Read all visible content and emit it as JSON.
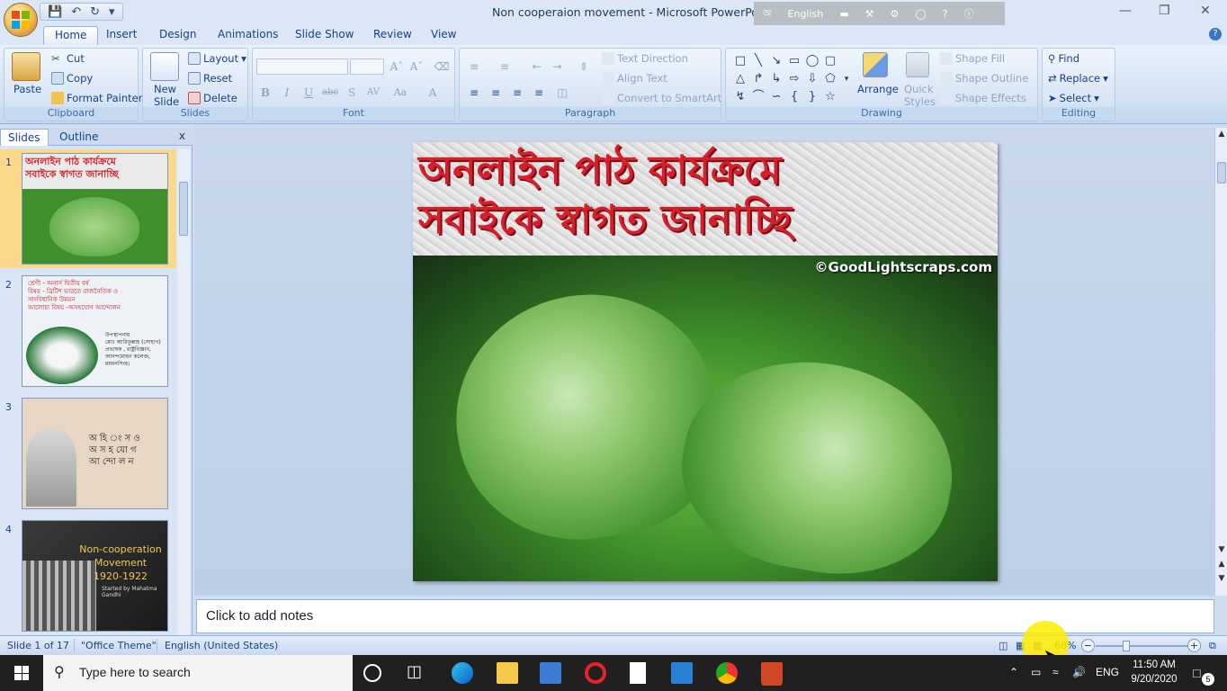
{
  "window": {
    "title": "Non cooperaion movement - Microsoft PowerPoint",
    "language_indicator": "English"
  },
  "tabs": [
    "Home",
    "Insert",
    "Design",
    "Animations",
    "Slide Show",
    "Review",
    "View"
  ],
  "ribbon": {
    "clipboard": {
      "paste": "Paste",
      "cut": "Cut",
      "copy": "Copy",
      "format_painter": "Format Painter",
      "label": "Clipboard"
    },
    "slides": {
      "new_slide": "New\nSlide",
      "new_slide_line1": "New",
      "new_slide_line2": "Slide",
      "layout": "Layout",
      "reset": "Reset",
      "delete": "Delete",
      "label": "Slides"
    },
    "font": {
      "label": "Font",
      "buttons": [
        "B",
        "I",
        "U",
        "abc",
        "S",
        "AV",
        "Aa",
        "A"
      ]
    },
    "paragraph": {
      "text_direction": "Text Direction",
      "align_text": "Align Text",
      "convert_smartart": "Convert to SmartArt",
      "label": "Paragraph"
    },
    "drawing": {
      "arrange": "Arrange",
      "quick_styles_line1": "Quick",
      "quick_styles_line2": "Styles",
      "shape_fill": "Shape Fill",
      "shape_outline": "Shape Outline",
      "shape_effects": "Shape Effects",
      "label": "Drawing"
    },
    "editing": {
      "find": "Find",
      "replace": "Replace",
      "select": "Select",
      "label": "Editing"
    }
  },
  "left_pane": {
    "tabs": [
      "Slides",
      "Outline"
    ],
    "close": "x",
    "slides": [
      {
        "number": "1",
        "title_line1": "অনলাইন পাঠ কার্যক্রমে",
        "title_line2": "সবাইকে স্বাগত জানাচ্ছি",
        "selected": true
      },
      {
        "number": "2",
        "lines": [
          "শ্রেণী - অনার্স দ্বিতীয় বর্ষ",
          "বিষয় - ব্রিটিশ ভারতে রাজনৈতিক ও",
          "সাংবিধানিক উন্নয়ন",
          "আলোচ্য বিষয় -অসহযোগ আন্দোলন"
        ],
        "presenter": [
          "উপস্থাপনায়",
          "মোঃ আরিফুল্লাহ (সোহাগ)",
          "প্রভাষক , রাষ্ট্রবিজ্ঞান,",
          "আনন্দমোহন কলেজ,",
          "ময়মনসিংহ।"
        ]
      },
      {
        "number": "3",
        "lines": [
          "অ হি ং স  ও",
          "অ স হ যো গ",
          "আ ন্দো ল ন"
        ]
      },
      {
        "number": "4",
        "lines": [
          "Non-cooperation",
          "Movement",
          "1920-1922"
        ],
        "subtitle": "Started by Mahatma Gandhi"
      }
    ]
  },
  "slide": {
    "title_line1": "অনলাইন পাঠ কার্যক্রমে",
    "title_line2": "সবাইকে স্বাগত জানাচ্ছি",
    "watermark": "©GoodLightscraps.com"
  },
  "notes": {
    "placeholder": "Click to add notes"
  },
  "status": {
    "slide_position": "Slide 1 of 17",
    "theme": "\"Office Theme\"",
    "language": "English (United States)",
    "zoom": "68%"
  },
  "taskbar": {
    "search_placeholder": "Type here to search",
    "lang": "ENG",
    "time": "11:50 AM",
    "date": "9/20/2020",
    "notification_count": "5"
  },
  "colors": {
    "accent": "#15428b",
    "title_red": "#d61f2a",
    "selection": "#fbd98a"
  }
}
